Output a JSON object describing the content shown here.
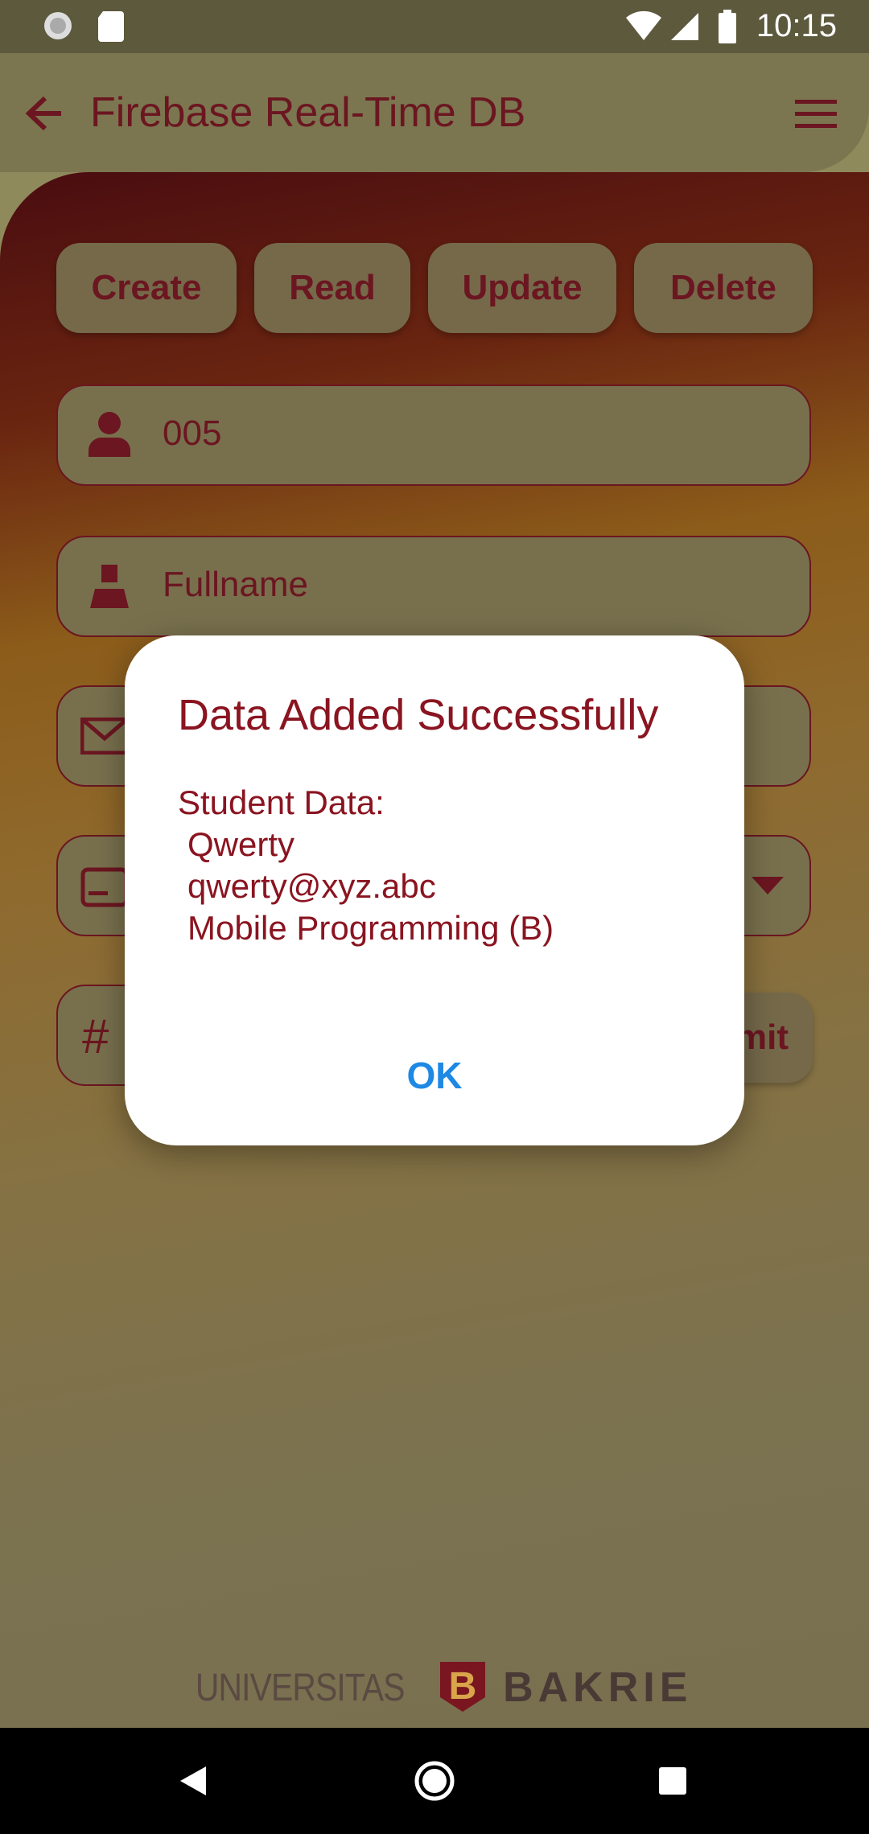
{
  "status_bar": {
    "time": "10:15"
  },
  "app_bar": {
    "title": "Firebase Real-Time DB"
  },
  "crud_buttons": [
    {
      "label": "Create"
    },
    {
      "label": "Read"
    },
    {
      "label": "Update"
    },
    {
      "label": "Delete"
    }
  ],
  "form": {
    "id_value": "005",
    "fullname_placeholder": "Fullname",
    "submit_label": "Submit"
  },
  "dialog": {
    "title": "Data Added Successfully",
    "body_heading": "Student Data:",
    "name": "Qwerty",
    "email": "qwerty@xyz.abc",
    "course": "Mobile Programming (B)",
    "ok_label": "OK"
  },
  "footer_logo": {
    "left_text": "UNIVERSITAS",
    "right_text": "BAKRIE"
  },
  "colors": {
    "accent": "#6b1620",
    "dialog_text": "#8a1420",
    "ok_button": "#1e88e5"
  }
}
